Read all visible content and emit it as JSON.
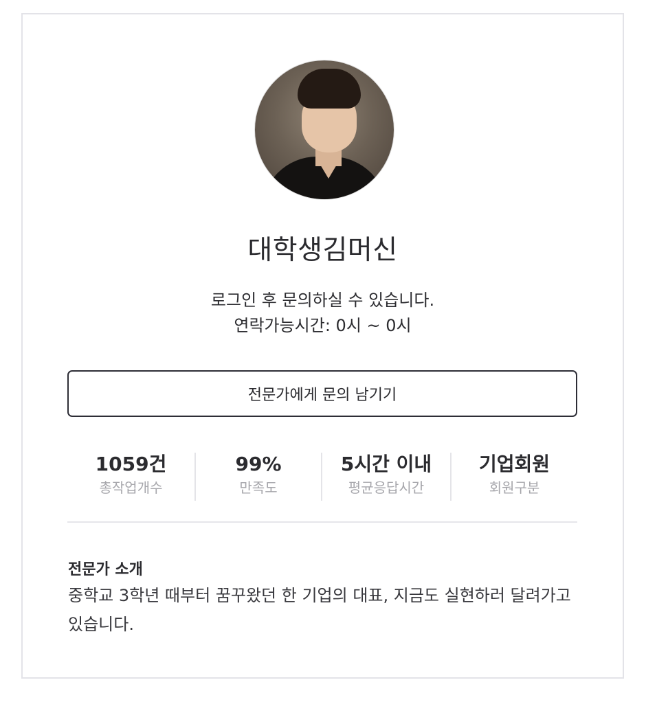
{
  "profile": {
    "name": "대학생김머신",
    "notice_line1": "로그인 후 문의하실 수 있습니다.",
    "notice_line2": "연락가능시간: 0시 ~ 0시"
  },
  "actions": {
    "inquiry_label": "전문가에게 문의 남기기"
  },
  "stats": [
    {
      "value": "1059건",
      "label": "총작업개수"
    },
    {
      "value": "99%",
      "label": "만족도"
    },
    {
      "value": "5시간 이내",
      "label": "평균응답시간"
    },
    {
      "value": "기업회원",
      "label": "회원구분"
    }
  ],
  "intro": {
    "title": "전문가 소개",
    "body": "중학교 3학년 때부터 꿈꾸왔던 한 기업의 대표, 지금도 실현하러 달려가고 있습니다."
  }
}
